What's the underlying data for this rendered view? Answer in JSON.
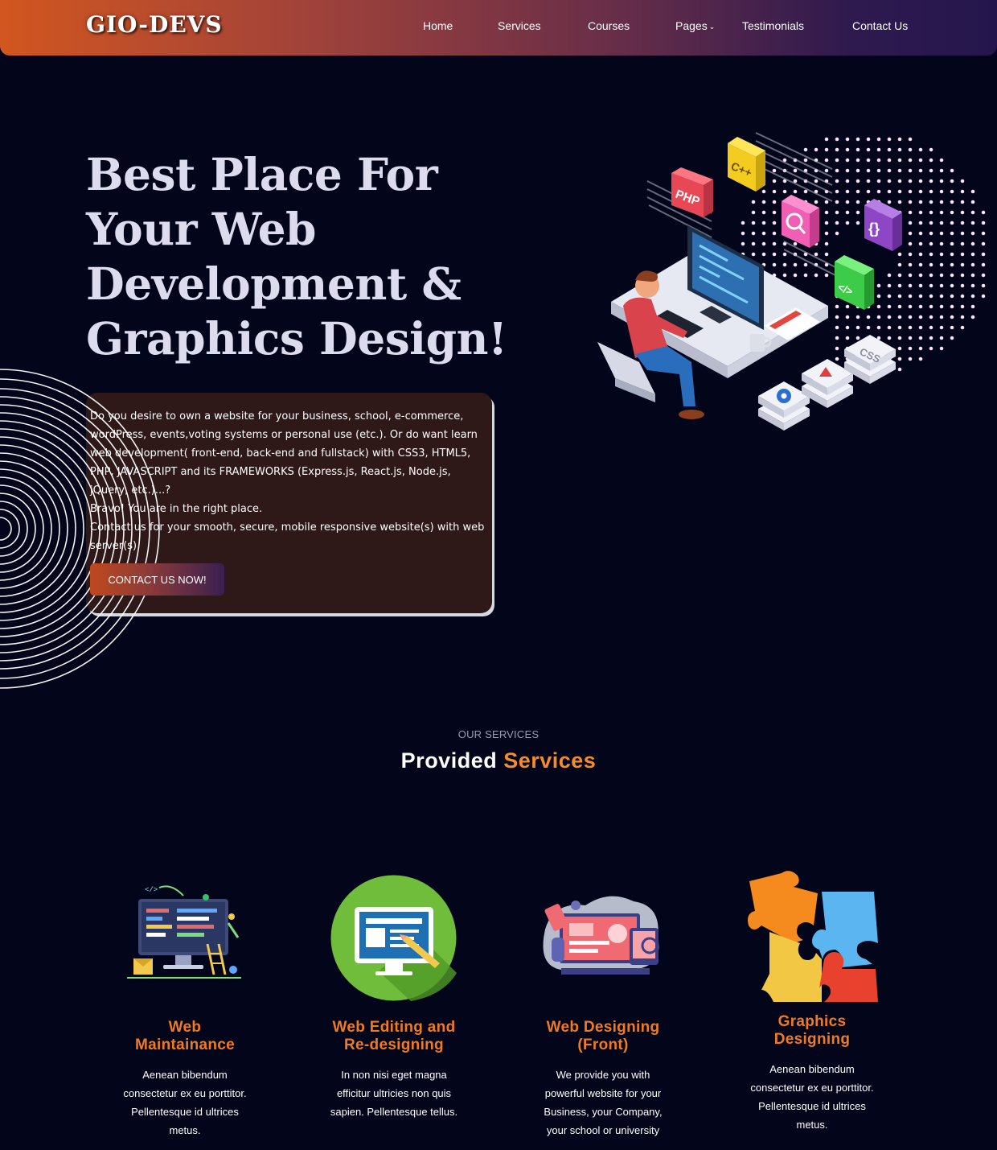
{
  "header": {
    "logo": "GIO-DEVS",
    "nav": [
      {
        "label": "Home"
      },
      {
        "label": "Services"
      },
      {
        "label": "Courses"
      },
      {
        "label": "Pages",
        "dropdown": true,
        "icon": "chevron-down-icon"
      },
      {
        "label": "Testimonials"
      },
      {
        "label": "Contact Us"
      }
    ]
  },
  "hero": {
    "title_lines": [
      "Best Place For",
      "Your Web",
      "Development &",
      "Graphics Design!"
    ],
    "paragraphs": [
      "Do you desire to own a website for your business, school, e-commerce, wordPress, events,voting systems or personal use (etc.). Or do want learn web development( front-end, back-end and fullstack) with CSS3, HTML5, PHP, JAVASCRIPT and its FRAMEWORKS (Express.js, React.js, Node.js, jQuery, etc.)...?",
      "Bravo! You are in the right place.",
      "Contact us for your smooth, secure, mobile responsive website(s) with web server(s)."
    ],
    "cta_label": "CONTACT US NOW!",
    "illustration": {
      "badges": [
        "PHP",
        "C++",
        "{}",
        "</>",
        "CSS"
      ]
    }
  },
  "services": {
    "eyebrow": "OUR SERVICES",
    "title_white": "Provided",
    "title_accent": "Services",
    "items": [
      {
        "title_lines": [
          "Web",
          "Maintainance"
        ],
        "desc": "Aenean bibendum consectetur ex eu porttitor. Pellentesque id ultrices metus.",
        "icon": "dashboard-monitor-icon"
      },
      {
        "title_lines": [
          "Web Editing and",
          "Re-designing"
        ],
        "desc": "In non nisi eget magna efficitur ultricies non quis sapien. Pellentesque tellus.",
        "icon": "monitor-edit-icon"
      },
      {
        "title_lines": [
          "Web Designing",
          "(Front)"
        ],
        "desc": "We provide you with powerful website for your Business, your Company, your school or university",
        "icon": "design-workspace-icon"
      },
      {
        "title_lines": [
          "Graphics",
          "Designing"
        ],
        "desc": "Aenean bibendum consectetur ex eu porttitor. Pellentesque id ultrices metus.",
        "icon": "puzzle-icon"
      }
    ]
  },
  "colors": {
    "background": "#03061a",
    "accent": "#f07a24",
    "header_start": "#d2561f",
    "header_end": "#24164d",
    "card": "#2e1818"
  }
}
